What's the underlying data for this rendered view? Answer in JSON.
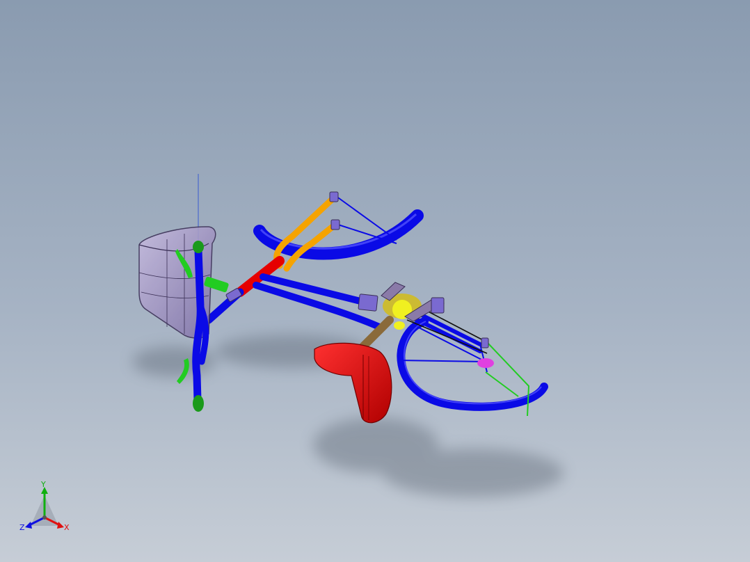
{
  "viewport": {
    "background": {
      "top": "#8a9bb0",
      "mid": "#a6b3c4",
      "bottom": "#c6cdd6"
    }
  },
  "model": {
    "colors": {
      "frame": "#0a0ae6",
      "frame_dark": "#0000a8",
      "handlebar": "#f5a300",
      "head_tube": "#e60000",
      "basket": "#a89cc4",
      "basket_edge": "#3a2f55",
      "lever": "#22cc22",
      "saddle": "#e81010",
      "seatpost": "#8a6a3a",
      "grip": "#1a9a1a",
      "brake_block": "#7a6ad0",
      "crank_gold": "#ccbb33",
      "crank_yellow": "#f0f020",
      "hub_pink": "#e040e0",
      "chain": "#111111",
      "shadow": "#4a5260"
    }
  },
  "triad": {
    "x_label": "X",
    "y_label": "Y",
    "z_label": "Z",
    "x_color": "#e01010",
    "y_color": "#10b010",
    "z_color": "#1010e0"
  }
}
